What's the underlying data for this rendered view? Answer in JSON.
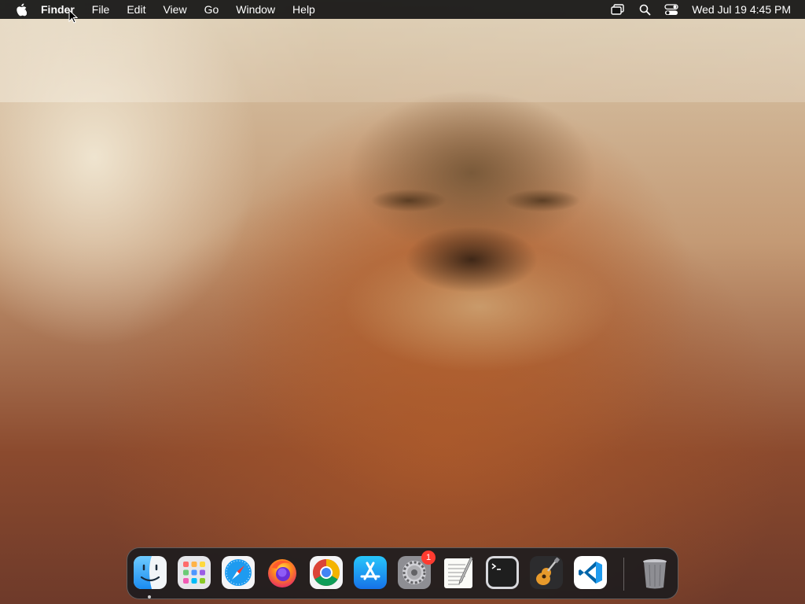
{
  "menubar": {
    "apple_icon": "apple-logo-icon",
    "items": [
      "Finder",
      "File",
      "Edit",
      "View",
      "Go",
      "Window",
      "Help"
    ],
    "status_icons": [
      "screen-mirroring-icon",
      "search-icon",
      "control-center-icon"
    ],
    "clock": "Wed Jul 19  4:45 PM"
  },
  "dock": {
    "apps": [
      {
        "name": "Finder",
        "icon": "finder-icon",
        "running": true
      },
      {
        "name": "Launchpad",
        "icon": "launchpad-icon"
      },
      {
        "name": "Safari",
        "icon": "safari-icon"
      },
      {
        "name": "Firefox",
        "icon": "firefox-icon"
      },
      {
        "name": "Google Chrome",
        "icon": "chrome-icon"
      },
      {
        "name": "App Store",
        "icon": "app-store-icon"
      },
      {
        "name": "System Settings",
        "icon": "system-settings-icon",
        "badge": "1"
      },
      {
        "name": "TextEdit",
        "icon": "textedit-icon"
      },
      {
        "name": "Terminal",
        "icon": "terminal-icon"
      },
      {
        "name": "GarageBand",
        "icon": "garageband-icon"
      },
      {
        "name": "Visual Studio Code",
        "icon": "vscode-icon"
      },
      {
        "name": "Trash",
        "icon": "trash-icon"
      }
    ]
  },
  "colors": {
    "menubar_bg": "#141414",
    "dock_bg": "#1c1c1e",
    "badge": "#ff3b30"
  }
}
